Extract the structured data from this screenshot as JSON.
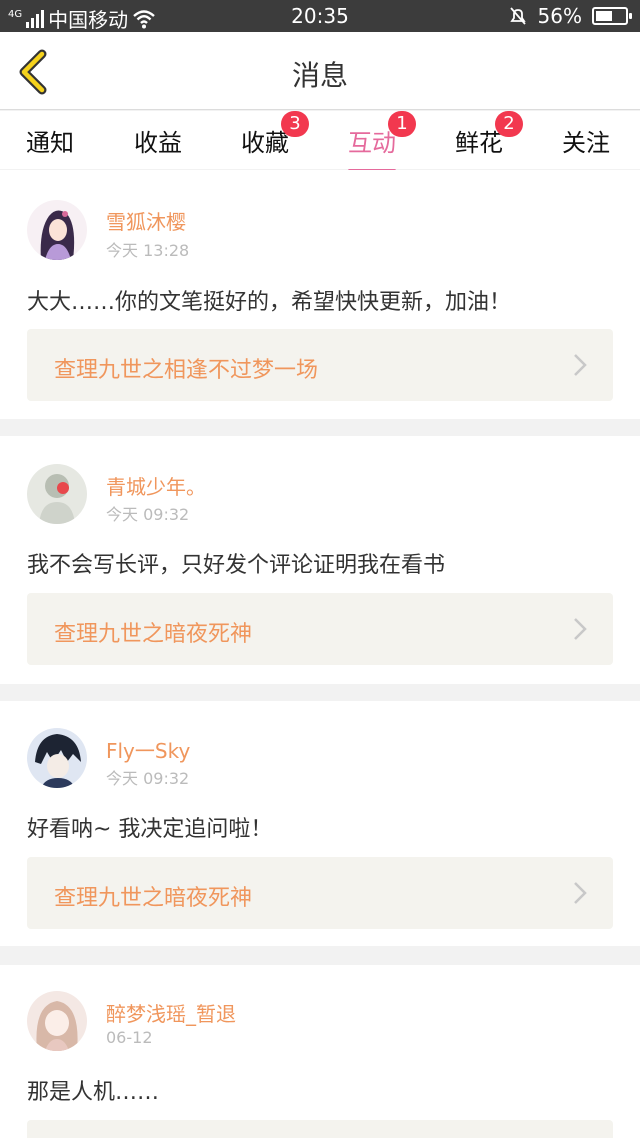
{
  "status_bar": {
    "network_label": "4G",
    "carrier": "中国移动",
    "time": "20:35",
    "battery": "56%",
    "battery_level": 0.56,
    "icons": [
      "signal-icon",
      "wifi-icon",
      "bell-muted-icon",
      "battery-icon"
    ]
  },
  "header": {
    "title": "消息",
    "back_icon": "chevron-left-icon"
  },
  "tabs": [
    {
      "label": "通知",
      "badge": ""
    },
    {
      "label": "收益",
      "badge": ""
    },
    {
      "label": "收藏",
      "badge": "3"
    },
    {
      "label": "互动",
      "badge": "1",
      "active": true
    },
    {
      "label": "鲜花",
      "badge": "2"
    },
    {
      "label": "关注",
      "badge": ""
    }
  ],
  "colors": {
    "accent_pink": "#e56a9c",
    "name_orange": "#f0965c",
    "badge_red": "#f2384f"
  },
  "messages": [
    {
      "user": "雪狐沐樱",
      "time": "今天 13:28",
      "comment": "大大……你的文笔挺好的，希望快快更新，加油！",
      "book": "查理九世之相逢不过梦一场"
    },
    {
      "user": "青城少年。",
      "time": "今天 09:32",
      "comment": "我不会写长评，只好发个评论证明我在看书",
      "book": "查理九世之暗夜死神"
    },
    {
      "user": "Fly一Sky",
      "time": "今天 09:32",
      "comment": "好看呐~ 我决定追问啦！",
      "book": "查理九世之暗夜死神"
    },
    {
      "user": "醉梦浅瑶_暂退",
      "time": "06-12",
      "comment": "那是人机……",
      "book": ""
    }
  ]
}
